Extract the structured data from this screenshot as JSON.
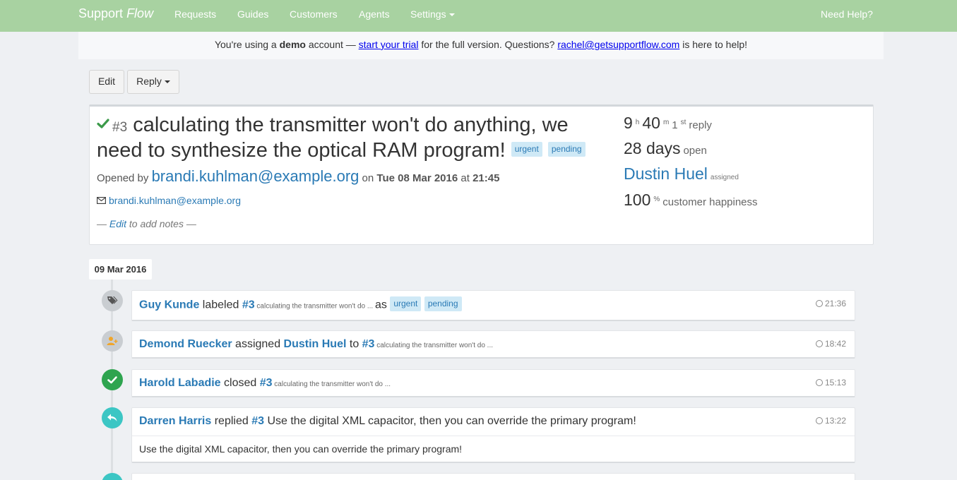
{
  "navbar": {
    "brand_main": "Support",
    "brand_italic": "Flow",
    "items": [
      "Requests",
      "Guides",
      "Customers",
      "Agents",
      "Settings"
    ],
    "help": "Need Help?"
  },
  "demo": {
    "t1": "You're using a ",
    "bold": "demo",
    "t2": " account — ",
    "trial_link": "start your trial",
    "t3": " for the full version. Questions? ",
    "email_link": "rachel@getsupportflow.com",
    "t4": " is here to help!"
  },
  "toolbar": {
    "edit": "Edit",
    "reply": "Reply"
  },
  "ticket": {
    "number": "#3",
    "title": "calculating the transmitter won't do anything, we need to synthesize the optical RAM program!",
    "labels": [
      "urgent",
      "pending"
    ],
    "opened_by": "Opened by ",
    "requester": "brandi.kuhlman@example.org",
    "on": " on ",
    "date": "Tue 08 Mar 2016",
    "at": " at ",
    "time": "21:45",
    "email": "brandi.kuhlman@example.org",
    "notes_prefix": "— ",
    "notes_edit": "Edit",
    "notes_suffix": " to add notes —"
  },
  "stats": {
    "hours": "9",
    "h": "h",
    "minutes": "40",
    "m": "m",
    "first": "1",
    "st": "st",
    "reply_label": "reply",
    "days": "28 days",
    "open_label": "open",
    "agent": "Dustin Huel",
    "assigned": "assigned",
    "happiness": "100",
    "pct": "%",
    "happiness_label": "customer happiness"
  },
  "timeline": {
    "date": "09 Mar 2016",
    "events": [
      {
        "actor": "Guy Kunde",
        "verb": " labeled ",
        "num": "#3",
        "excerpt": " calculating the transmitter won't do ... ",
        "as": "as",
        "labels": [
          "urgent",
          "pending"
        ],
        "time": "21:36"
      },
      {
        "actor": "Demond Ruecker",
        "verb": " assigned ",
        "target": "Dustin Huel",
        "to": " to ",
        "num": "#3",
        "excerpt": " calculating the transmitter won't do ...",
        "time": "18:42"
      },
      {
        "actor": "Harold Labadie",
        "verb": " closed ",
        "num": "#3",
        "excerpt": " calculating the transmitter won't do ...",
        "time": "15:13"
      },
      {
        "actor": "Darren Harris",
        "verb": " replied ",
        "num": "#3",
        "text": " Use the digital XML capacitor, then you can override the primary program!",
        "time": "13:22",
        "body": "Use the digital XML capacitor, then you can override the primary program!"
      }
    ]
  },
  "colors": {
    "navbar": "#a8d2a1",
    "link": "#2a7ab5",
    "tag_icon": "#c9cdd1",
    "assign_icon": "#f0a52a",
    "close_icon": "#2ea44f",
    "reply_icon": "#3cc6c4"
  }
}
